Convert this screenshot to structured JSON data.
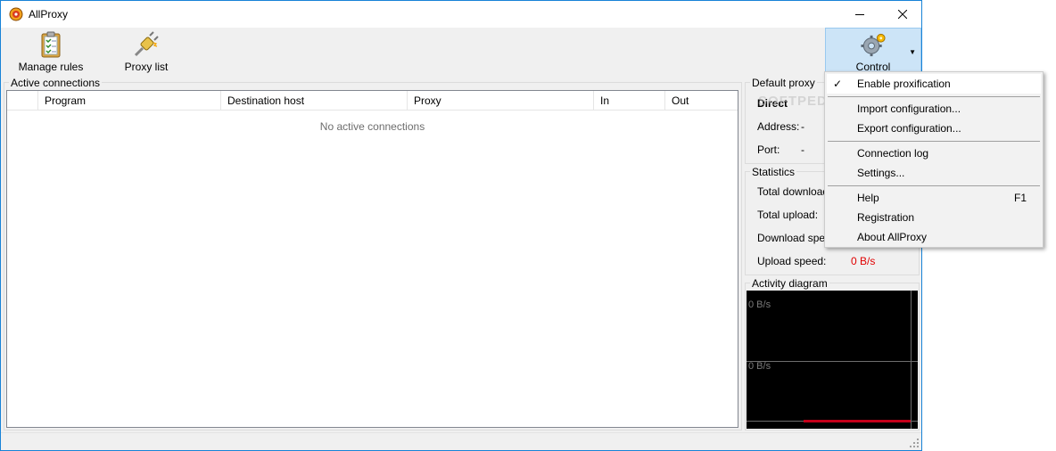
{
  "window": {
    "title": "AllProxy"
  },
  "toolbar": {
    "manage_rules": "Manage rules",
    "proxy_list": "Proxy list",
    "control": "Control"
  },
  "active_connections": {
    "title": "Active connections",
    "columns": [
      "Program",
      "Destination host",
      "Proxy",
      "In",
      "Out"
    ],
    "empty_text": "No active connections"
  },
  "default_proxy": {
    "title": "Default proxy",
    "type": "Direct",
    "address_label": "Address:",
    "address_value": "-",
    "port_label": "Port:",
    "port_value": "-"
  },
  "statistics": {
    "title": "Statistics",
    "total_download_label": "Total download:",
    "total_upload_label": "Total upload:",
    "download_speed_label": "Download speed:",
    "upload_speed_label": "Upload speed:",
    "upload_speed_value": "0 B/s"
  },
  "activity_diagram": {
    "title": "Activity diagram",
    "top_label": "0 B/s",
    "mid_label": "0 B/s"
  },
  "control_menu": {
    "items": [
      {
        "label": "Enable proxification",
        "checked": true,
        "shortcut": ""
      },
      {
        "label": "Import configuration...",
        "shortcut": ""
      },
      {
        "label": "Export configuration...",
        "shortcut": ""
      },
      {
        "label": "Connection log",
        "shortcut": ""
      },
      {
        "label": "Settings...",
        "shortcut": ""
      },
      {
        "label": "Help",
        "shortcut": "F1"
      },
      {
        "label": "Registration",
        "shortcut": ""
      },
      {
        "label": "About AllProxy",
        "shortcut": ""
      }
    ],
    "check_glyph": "✓"
  },
  "watermark": "SOFTPEDIA",
  "colors": {
    "accent": "#1883d7",
    "speed_value": "#e00000",
    "diagram_bg": "#000000",
    "diagram_red": "#c4001a",
    "menu_highlight": "#ffffff"
  },
  "icons": {
    "app": "allproxy-logo-icon",
    "manage_rules": "clipboard-checklist-icon",
    "proxy_list": "plug-icon",
    "control": "gears-icon"
  }
}
